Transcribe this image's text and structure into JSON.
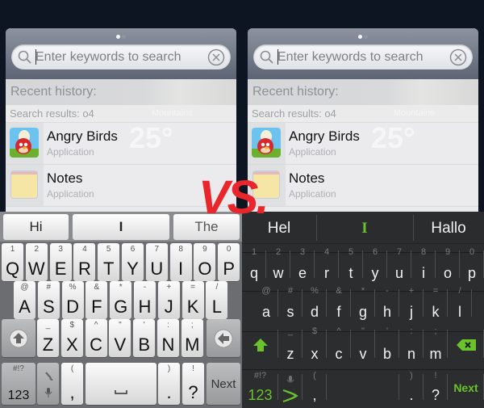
{
  "comparison_label": "VS.",
  "panels": [
    {
      "id": "left",
      "search": {
        "placeholder": "Enter keywords to search",
        "recent_label": "Recent history:",
        "results_label": "Search results: o4",
        "results": [
          {
            "title": "Angry Birds",
            "subtitle": "Application",
            "icon": "angry-birds-icon"
          },
          {
            "title": "Notes",
            "subtitle": "Application",
            "icon": "notes-icon"
          }
        ],
        "weather_temp": "25°",
        "weather_city": "Mountains"
      },
      "keyboard": {
        "style": "light",
        "suggestions": [
          "Hi",
          "I",
          "The"
        ],
        "rows": [
          [
            [
              "1",
              "Q"
            ],
            [
              "2",
              "W"
            ],
            [
              "3",
              "E"
            ],
            [
              "4",
              "R"
            ],
            [
              "5",
              "T"
            ],
            [
              "6",
              "Y"
            ],
            [
              "7",
              "U"
            ],
            [
              "8",
              "I"
            ],
            [
              "9",
              "O"
            ],
            [
              "0",
              "P"
            ]
          ],
          [
            [
              "@",
              "A"
            ],
            [
              "#",
              "S"
            ],
            [
              "%",
              "D"
            ],
            [
              "&",
              "F"
            ],
            [
              "*",
              "G"
            ],
            [
              "-",
              "H"
            ],
            [
              "+",
              "J"
            ],
            [
              "=",
              "K"
            ],
            [
              "/",
              "L"
            ]
          ],
          [
            [
              "_",
              "Z"
            ],
            [
              "$",
              "X"
            ],
            [
              "^",
              "C"
            ],
            [
              "\"",
              "V"
            ],
            [
              "'",
              "B"
            ],
            [
              ":",
              "N"
            ],
            [
              ";",
              "M"
            ]
          ]
        ],
        "shift_icon": "shift-arrow-icon",
        "backspace_icon": "backspace-arrow-icon",
        "bottom": {
          "symbols_secondary": "#!?",
          "symbols_primary": "123",
          "tools_icon": "wrench-icon",
          "mic_icon": "microphone-icon",
          "comma_secondary": "(",
          "comma_primary": ",",
          "space_icon": "space-bar-icon",
          "period_secondary": ")",
          "period_primary": ".",
          "question_secondary": "!",
          "question_primary": "?",
          "action_label": "Next"
        }
      }
    },
    {
      "id": "right",
      "search": {
        "placeholder": "Enter keywords to search",
        "recent_label": "Recent history:",
        "results_label": "Search results: o4",
        "results": [
          {
            "title": "Angry Birds",
            "subtitle": "Application",
            "icon": "angry-birds-icon"
          },
          {
            "title": "Notes",
            "subtitle": "Application",
            "icon": "notes-icon"
          }
        ],
        "weather_temp": "25°",
        "weather_city": "Mountains"
      },
      "keyboard": {
        "style": "dark",
        "suggestions": [
          "Hel",
          "I",
          "Hallo"
        ],
        "rows": [
          [
            [
              "1",
              "q"
            ],
            [
              "2",
              "w"
            ],
            [
              "3",
              "e"
            ],
            [
              "4",
              "r"
            ],
            [
              "5",
              "t"
            ],
            [
              "6",
              "y"
            ],
            [
              "7",
              "u"
            ],
            [
              "8",
              "i"
            ],
            [
              "9",
              "o"
            ],
            [
              "0",
              "p"
            ]
          ],
          [
            [
              "@",
              "a"
            ],
            [
              "#",
              "s"
            ],
            [
              "%",
              "d"
            ],
            [
              "&",
              "f"
            ],
            [
              "*",
              "g"
            ],
            [
              "-",
              "h"
            ],
            [
              "+",
              "j"
            ],
            [
              "=",
              "k"
            ],
            [
              "/",
              "l"
            ]
          ],
          [
            [
              "_",
              "z"
            ],
            [
              "$",
              "x"
            ],
            [
              "^",
              "c"
            ],
            [
              "\"",
              "v"
            ],
            [
              "'",
              "b"
            ],
            [
              ":",
              "n"
            ],
            [
              ";",
              "m"
            ]
          ]
        ],
        "shift_icon": "shift-arrow-icon",
        "backspace_icon": "backspace-x-icon",
        "bottom": {
          "symbols_secondary": "#!?",
          "symbols_primary": "123",
          "mic_icon": "microphone-icon",
          "swype_icon": "swype-logo-icon",
          "comma_secondary": "(",
          "comma_primary": ",",
          "period_secondary": ")",
          "period_primary": ".",
          "question_secondary": "!",
          "question_primary": "?",
          "action_label": "Next"
        },
        "accent_color": "#6ac32a"
      }
    }
  ]
}
